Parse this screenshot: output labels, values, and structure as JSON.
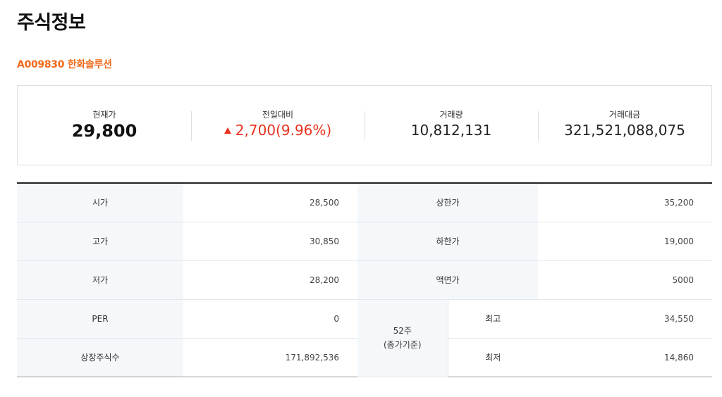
{
  "page": {
    "title": "주식정보",
    "stock_code": "A009830 한화솔루션"
  },
  "summary": [
    {
      "label": "현재가",
      "value": "29,800"
    },
    {
      "label": "전일대비",
      "value": "2,700(9.96%)",
      "direction": "up"
    },
    {
      "label": "거래량",
      "value": "10,812,131"
    },
    {
      "label": "거래대금",
      "value": "321,521,088,075"
    }
  ],
  "colors": {
    "accent_orange": "#f06a1d",
    "up_red": "#e8321e",
    "header_bg": "#f5f8fb"
  },
  "table": {
    "open": {
      "label": "시가",
      "value": "28,500"
    },
    "upper_limit": {
      "label": "상한가",
      "value": "35,200"
    },
    "high": {
      "label": "고가",
      "value": "30,850"
    },
    "lower_limit": {
      "label": "하한가",
      "value": "19,000"
    },
    "low": {
      "label": "저가",
      "value": "28,200"
    },
    "face_value": {
      "label": "액면가",
      "value": "5000"
    },
    "per": {
      "label": "PER",
      "value": "0"
    },
    "listed_shares": {
      "label": "상장주식수",
      "value": "171,892,536"
    },
    "week52": {
      "label_line1": "52주",
      "label_line2": "(종가기준)",
      "high": {
        "label": "최고",
        "value": "34,550"
      },
      "low": {
        "label": "최저",
        "value": "14,860"
      }
    }
  }
}
